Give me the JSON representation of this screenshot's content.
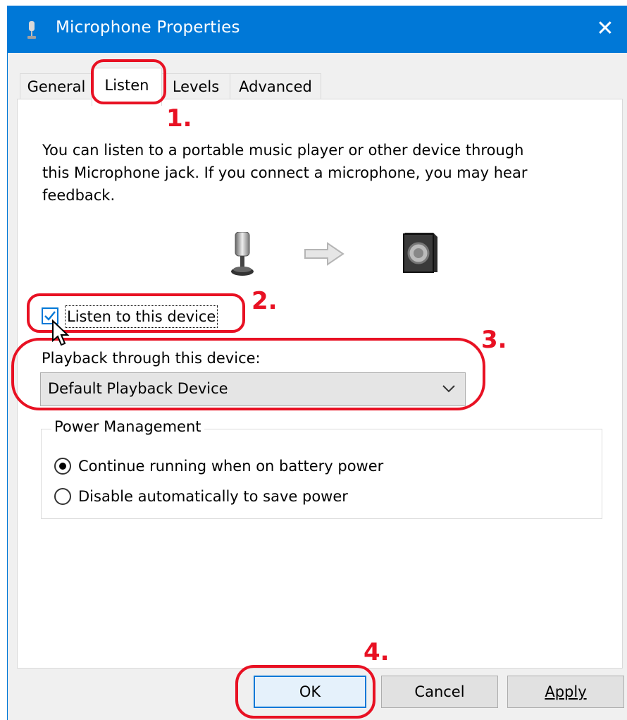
{
  "window": {
    "title": "Microphone Properties",
    "close_glyph": "✕",
    "accent_color": "#0078d7"
  },
  "tabs": [
    {
      "label": "General",
      "active": false
    },
    {
      "label": "Listen",
      "active": true
    },
    {
      "label": "Levels",
      "active": false
    },
    {
      "label": "Advanced",
      "active": false
    }
  ],
  "listen": {
    "description_lines": [
      "You can listen to a portable music player or other device through",
      "this Microphone jack.  If you connect a microphone, you may hear",
      "feedback."
    ],
    "diagram_icons": [
      "microphone-icon",
      "arrow-right-icon",
      "speaker-icon"
    ],
    "listen_checkbox": {
      "label": "Listen to this device",
      "checked": true
    },
    "playback_label": "Playback through this device:",
    "playback_device": "Default Playback Device",
    "power_management": {
      "legend": "Power Management",
      "options": [
        {
          "label": "Continue running when on battery power",
          "selected": true
        },
        {
          "label": "Disable automatically to save power",
          "selected": false
        }
      ]
    }
  },
  "buttons": {
    "ok": "OK",
    "cancel": "Cancel",
    "apply": "Apply"
  },
  "annotations": {
    "color": "#e81123",
    "labels": [
      "1.",
      "2.",
      "3.",
      "4."
    ]
  }
}
